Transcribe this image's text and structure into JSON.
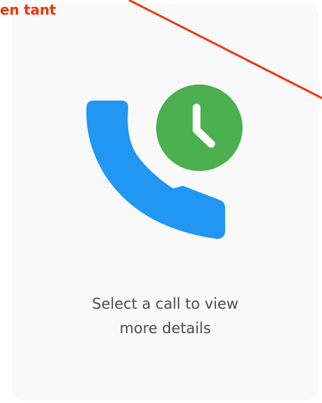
{
  "annotation": {
    "text": "en tant",
    "color": "#f0360a"
  },
  "empty_state": {
    "message_line1": "Select a call to view",
    "message_line2": "more details",
    "phone_icon_color": "#2196f3",
    "clock_badge_color": "#4caf50",
    "clock_hands_color": "#ffffff"
  },
  "icons": {
    "phone": "phone-handset-icon",
    "clock": "clock-icon"
  }
}
